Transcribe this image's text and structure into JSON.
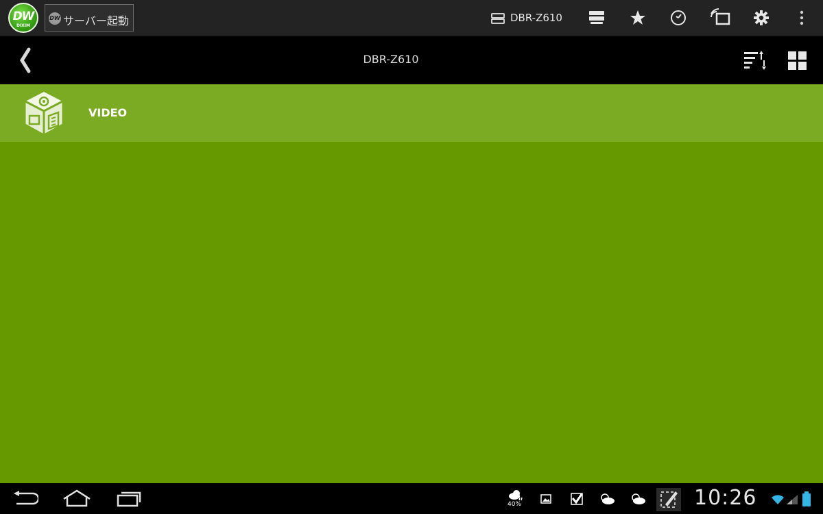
{
  "app": {
    "logo_text": "DW",
    "logo_subtext": "DIXIM",
    "server_button": {
      "mini": "DW",
      "label": "サーバー起動"
    },
    "connected_server": "DBR-Z610"
  },
  "toolbar_icons": [
    "server-list-icon",
    "star-icon",
    "clock-icon",
    "cast-icon",
    "gear-icon",
    "overflow-menu-icon"
  ],
  "subheader": {
    "title": "DBR-Z610",
    "icons": [
      "back-icon",
      "sort-icon",
      "grid-view-icon"
    ]
  },
  "list": {
    "items": [
      {
        "label": "VIDEO",
        "icon": "media-cube-icon"
      }
    ]
  },
  "system_bar": {
    "nav_icons": [
      "back-nav-icon",
      "home-nav-icon",
      "recent-apps-icon"
    ],
    "notification_icons": [
      "weather-icon",
      "gallery-icon",
      "checkmark-icon",
      "cloudy-icon",
      "sun-cloud-icon",
      "edit-icon"
    ],
    "weather_percent": "40%",
    "clock": "10:26",
    "status_icons": [
      "wifi-icon",
      "signal-icon",
      "battery-icon"
    ]
  },
  "colors": {
    "background": "#669900",
    "list_item": "#7aab22",
    "topbar": "#232323",
    "subheader": "#000000"
  }
}
